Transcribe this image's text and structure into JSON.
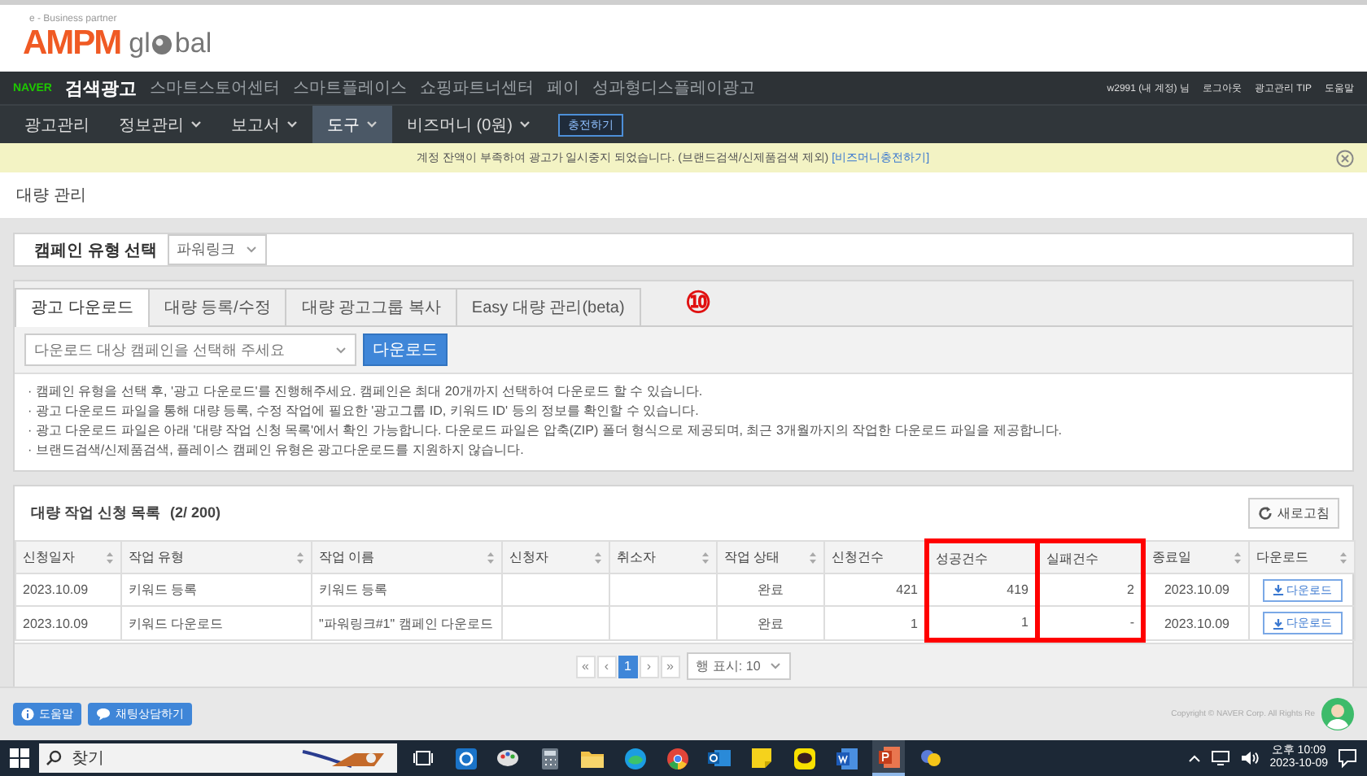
{
  "logo": {
    "tagline": "e - Business partner",
    "brand": "AMPM",
    "suffix": "gl",
    "suffix_end": "bal"
  },
  "topbar": {
    "brand": "NAVER",
    "title": "검색광고",
    "links": [
      "스마트스토어센터",
      "스마트플레이스",
      "쇼핑파트너센터",
      "페이",
      "성과형디스플레이광고"
    ],
    "user": "w2991 (내 계정) 님",
    "user_links": [
      "로그아웃",
      "광고관리 TIP",
      "도움말"
    ]
  },
  "nav": {
    "items": [
      {
        "label": "광고관리",
        "dropdown": false,
        "selected": false
      },
      {
        "label": "정보관리",
        "dropdown": true,
        "selected": false
      },
      {
        "label": "보고서",
        "dropdown": true,
        "selected": false
      },
      {
        "label": "도구",
        "dropdown": true,
        "selected": true
      },
      {
        "label": "비즈머니 (0원)",
        "dropdown": true,
        "selected": false
      }
    ],
    "charge_button": "충전하기"
  },
  "alert": {
    "message": "계정 잔액이 부족하여 광고가 일시중지 되었습니다. (브랜드검색/신제품검색 제외)",
    "link": "[비즈머니충전하기]"
  },
  "page_title": "대량 관리",
  "campaign_type": {
    "label": "캠페인 유형 선택",
    "value": "파워링크"
  },
  "tabs": [
    {
      "label": "광고 다운로드",
      "selected": true
    },
    {
      "label": "대량 등록/수정",
      "selected": false
    },
    {
      "label": "대량 광고그룹 복사",
      "selected": false
    },
    {
      "label": "Easy 대량 관리(beta)",
      "selected": false
    }
  ],
  "download": {
    "placeholder": "다운로드 대상 캠페인을 선택해 주세요",
    "button": "다운로드"
  },
  "marker": "⑩",
  "notes": [
    "· 캠페인 유형을 선택 후, '광고 다운로드'를 진행해주세요. 캠페인은 최대 20개까지 선택하여 다운로드 할 수 있습니다.",
    "· 광고 다운로드 파일을 통해 대량 등록, 수정 작업에 필요한 '광고그룹 ID, 키워드 ID' 등의 정보를 확인할 수 있습니다.",
    "· 광고 다운로드 파일은 아래 '대량 작업 신청 목록'에서 확인 가능합니다. 다운로드 파일은 압축(ZIP) 폴더 형식으로 제공되며, 최근 3개월까지의 작업한 다운로드 파일을 제공합니다.",
    "· 브랜드검색/신제품검색, 플레이스 캠페인 유형은 광고다운로드를 지원하지 않습니다."
  ],
  "job_list": {
    "title": "대량 작업 신청 목록",
    "count": "(2/ 200)",
    "refresh": "새로고침",
    "columns": [
      {
        "label": "신청일자",
        "sortable": true,
        "highlighted": false
      },
      {
        "label": "작업 유형",
        "sortable": true,
        "highlighted": false
      },
      {
        "label": "작업 이름",
        "sortable": true,
        "highlighted": false
      },
      {
        "label": "신청자",
        "sortable": true,
        "highlighted": false
      },
      {
        "label": "취소자",
        "sortable": true,
        "highlighted": false
      },
      {
        "label": "작업 상태",
        "sortable": true,
        "highlighted": false
      },
      {
        "label": "신청건수",
        "sortable": false,
        "highlighted": false
      },
      {
        "label": "성공건수",
        "sortable": false,
        "highlighted": true
      },
      {
        "label": "실패건수",
        "sortable": false,
        "highlighted": true
      },
      {
        "label": "종료일",
        "sortable": true,
        "highlighted": false
      },
      {
        "label": "다운로드",
        "sortable": true,
        "highlighted": false
      }
    ],
    "rows": [
      {
        "date": "2023.10.09",
        "type": "키워드 등록",
        "name": "키워드 등록",
        "status": "완료",
        "requested": "421",
        "success": "419",
        "failed": "2",
        "end_date": "2023.10.09",
        "download": "다운로드"
      },
      {
        "date": "2023.10.09",
        "type": "키워드 다운로드",
        "name": "\"파워링크#1\" 캠페인 다운로드",
        "status": "완료",
        "requested": "1",
        "success": "1",
        "failed": "-",
        "end_date": "2023.10.09",
        "download": "다운로드"
      }
    ],
    "pagination": {
      "first": "«",
      "prev": "‹",
      "pages": [
        {
          "label": "1",
          "selected": true
        }
      ],
      "next": "›",
      "last": "»",
      "page_size": "행 표시: 10"
    }
  },
  "footer": {
    "buttons": [
      "도움말",
      "채팅상담하기"
    ],
    "copyright": "Copyright © NAVER Corp. All Rights Re"
  },
  "taskbar": {
    "search": "찾기",
    "time": "오후 10:09",
    "date": "2023-10-09"
  }
}
